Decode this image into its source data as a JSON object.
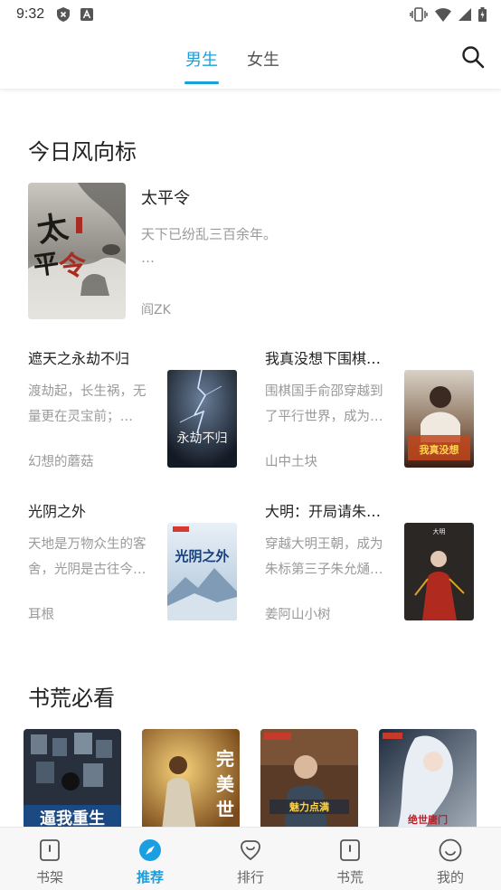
{
  "status_bar": {
    "time": "9:32"
  },
  "tabs": {
    "male": "男生",
    "female": "女生",
    "active": "male"
  },
  "accent_color": "#1a9fe0",
  "section_daily": {
    "title": "今日风向标",
    "featured": {
      "title": "太平令",
      "desc": "天下已纷乱三百余年。",
      "ellipsis": "…",
      "author": "阎ZK",
      "cover_text": "太平令"
    },
    "books": [
      {
        "title": "遮天之永劫不归",
        "desc": "渡劫起，长生祸，无量更在灵宝前；…",
        "author": "幻想的蘑菇",
        "cover_text": "永劫不归"
      },
      {
        "title": "我真没想下围棋啊！",
        "desc": "围棋国手俞邵穿越到了平行世界，成为…",
        "author": "山中土块",
        "cover_text": "我真没想下围棋啊"
      },
      {
        "title": "光阴之外",
        "desc": "天地是万物众生的客舍，光阴是古往今…",
        "author": "耳根",
        "cover_text": "光阴之外"
      },
      {
        "title": "大明：开局请朱元…",
        "desc": "穿越大明王朝，成为朱标第三子朱允熥…",
        "author": "姜阿山小树",
        "cover_text": "大明"
      }
    ]
  },
  "section_must": {
    "title": "书荒必看",
    "covers": [
      {
        "cover_text": "逼我重生"
      },
      {
        "cover_text": "完美世界"
      },
      {
        "cover_text": "魅力点满"
      },
      {
        "cover_text": "绝世唐门"
      }
    ]
  },
  "bottom_nav": [
    {
      "label": "书架",
      "icon": "bookshelf-icon"
    },
    {
      "label": "推荐",
      "icon": "compass-icon",
      "active": true
    },
    {
      "label": "排行",
      "icon": "ranking-icon"
    },
    {
      "label": "书荒",
      "icon": "book-shortage-icon"
    },
    {
      "label": "我的",
      "icon": "profile-icon"
    }
  ]
}
